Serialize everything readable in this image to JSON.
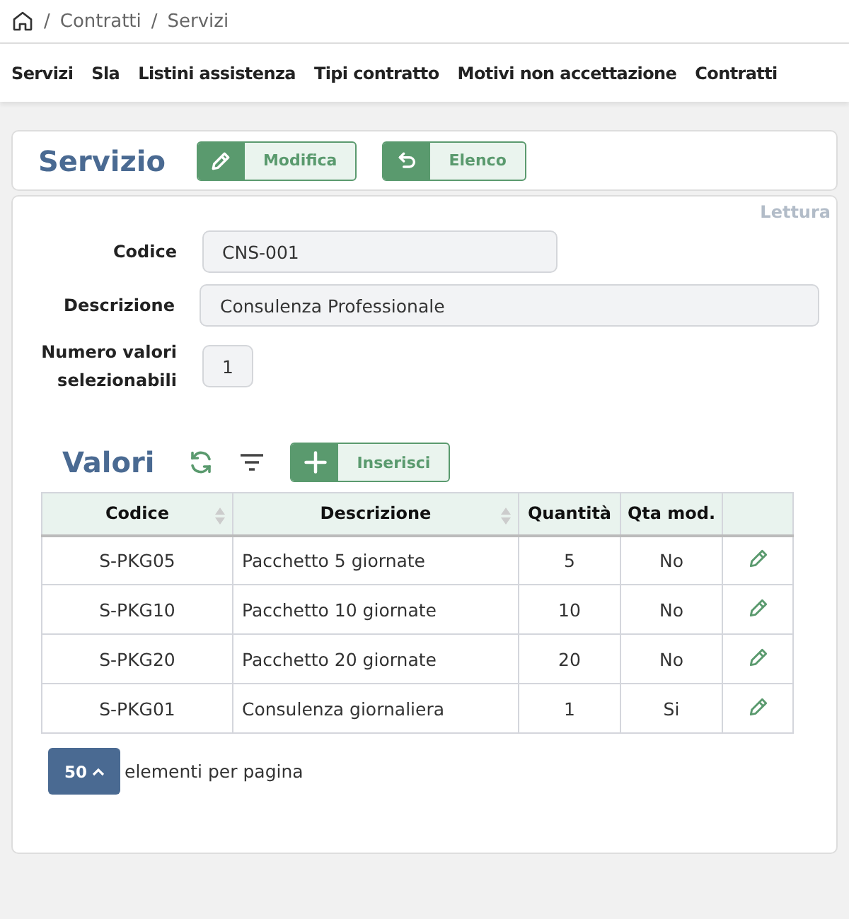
{
  "breadcrumb": [
    {
      "separator": "/",
      "label": "Contratti"
    },
    {
      "separator": "/",
      "label": "Servizi"
    }
  ],
  "nav": [
    "Servizi",
    "Sla",
    "Listini assistenza",
    "Tipi contratto",
    "Motivi non accettazione",
    "Contratti"
  ],
  "header": {
    "title": "Servizio",
    "buttons": [
      {
        "label": "Modifica",
        "kind": "edit"
      },
      {
        "label": "Elenco",
        "kind": "back"
      }
    ]
  },
  "mode": "Lettura",
  "fields": [
    {
      "label": "Codice",
      "value": "CNS-001",
      "kind": "text"
    },
    {
      "label": "Descrizione",
      "value": "Consulenza Professionale",
      "kind": "textarea"
    },
    {
      "label": "Numero valori selezionabili",
      "value": "1",
      "kind": "number"
    }
  ],
  "values": {
    "title": "Valori",
    "add_button": {
      "label": "Inserisci",
      "kind": "add"
    },
    "columns": [
      {
        "label": "Codice",
        "sortable": true
      },
      {
        "label": "Descrizione",
        "sortable": true
      },
      {
        "label": "Quantità",
        "sortable": false
      },
      {
        "label": "Qta mod.",
        "sortable": false
      }
    ],
    "rows": [
      {
        "codice": "S-PKG05",
        "descrizione": "Pacchetto 5 giornate",
        "quantita": "5",
        "qta_mod": "No"
      },
      {
        "codice": "S-PKG10",
        "descrizione": "Pacchetto 10 giornate",
        "quantita": "10",
        "qta_mod": "No"
      },
      {
        "codice": "S-PKG20",
        "descrizione": "Pacchetto 20 giornate",
        "quantita": "20",
        "qta_mod": "No"
      },
      {
        "codice": "S-PKG01",
        "descrizione": "Consulenza giornaliera",
        "quantita": "1",
        "qta_mod": "Si"
      }
    ],
    "page_size": "50",
    "page_size_label": "elementi per pagina"
  }
}
